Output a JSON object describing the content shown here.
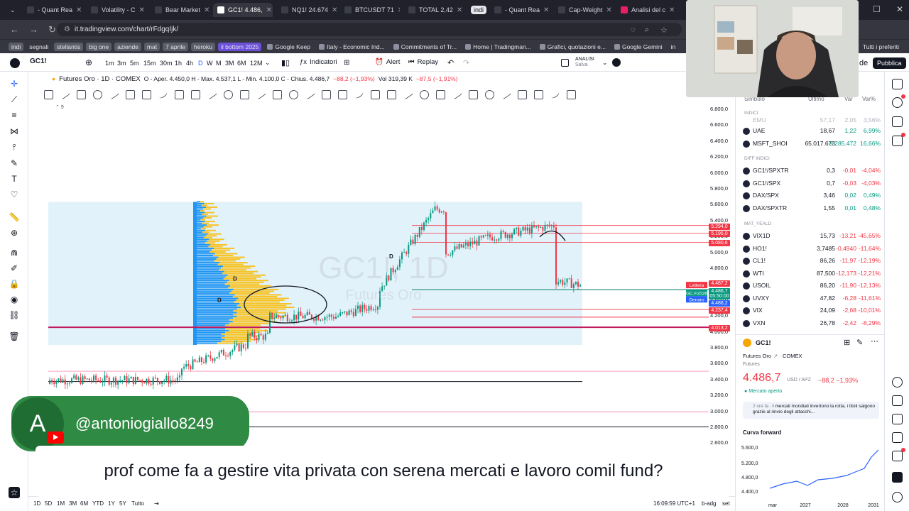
{
  "browser": {
    "tabs": [
      {
        "label": "- Quant Rea"
      },
      {
        "label": "Volatility - C"
      },
      {
        "label": "Bear Market"
      },
      {
        "label": "GC1! 4.486,"
      },
      {
        "label": "NQ1! 24.674"
      },
      {
        "label": "BTCUSDT 71"
      },
      {
        "label": "TOTAL 2,42"
      },
      {
        "label": "indi"
      },
      {
        "label": "- Quant Rea"
      },
      {
        "label": "Cap-Weight"
      },
      {
        "label": "Analisi del c"
      }
    ],
    "url": "it.tradingview.com/chart/rFdgqIjk/",
    "bookmarks": [
      "indi",
      "segnali",
      "stellantis",
      "big one",
      "aziende",
      "mat",
      "7 aprile",
      "heroku",
      "il bottom 2025",
      "Google Keep",
      "Italy - Economic Ind...",
      "Commitments of Tr...",
      "Home | Tradingman...",
      "Grafici, quotazioni e...",
      "Google Gemini",
      "in"
    ],
    "bookmarks_right": "Tutti i preferiti"
  },
  "toolbar": {
    "symbol": "GC1!",
    "timeframes": [
      "1m",
      "3m",
      "5m",
      "15m",
      "30m",
      "1h",
      "4h",
      "D",
      "W",
      "M",
      "3M",
      "6M",
      "12M"
    ],
    "selected_tf": "D",
    "indicators": "Indicatori",
    "alert": "Alert",
    "replay": "Replay",
    "analysis_top": "ANALISI",
    "analysis_bottom": "Salva",
    "publish": "Pubblica",
    "save_tail": "de"
  },
  "legend": {
    "name": "Futures Oro · 1D · COMEX",
    "ohlc": "O - Aper. 4.450,0  H - Max. 4.537,1  L - Min. 4.100,0  C - Chius. 4.486,7",
    "change": "−88,2 (−1,93%)",
    "vol": "Vol 319,39 K",
    "vol_change": "−87,5 (−1,91%)",
    "collapse": "9"
  },
  "watermark": {
    "symbol": "GC1!, 1D",
    "sub": "Futures Oro"
  },
  "price_axis": [
    "6.800,0",
    "6.600,0",
    "6.400,0",
    "6.200,0",
    "6.000,0",
    "5.800,0",
    "5.600,0",
    "5.400,0",
    "5.200,0",
    "5.000,0",
    "4.800,0",
    "4.600,0",
    "4.400,0",
    "4.200,0",
    "4.000,0",
    "3.800,0",
    "3.600,0",
    "3.400,0",
    "3.200,0",
    "3.000,0",
    "2.800,0",
    "2.600,0"
  ],
  "price_labels": [
    {
      "text": "5.294,0",
      "color": "#f23645"
    },
    {
      "text": "5.195,0",
      "color": "#f23645"
    },
    {
      "text": "5.080,6",
      "color": "#f23645"
    },
    {
      "text": "4.487,2",
      "color": "#f23645"
    },
    {
      "text": "4.486,7",
      "color": "#089981"
    },
    {
      "text": "05:50:00",
      "color": "#089981"
    },
    {
      "text": "4.486,2",
      "color": "#2962ff"
    },
    {
      "text": "4.237,4",
      "color": "#f23645"
    },
    {
      "text": "4.013,2",
      "color": "#f23645"
    }
  ],
  "side_tags": {
    "ask": "Lettera",
    "last": "GC.F2026",
    "bid": "Denaro"
  },
  "chart_marks": [
    "D",
    "D",
    "D"
  ],
  "bottombar": {
    "ranges": [
      "1D",
      "5D",
      "1M",
      "3M",
      "6M",
      "YTD",
      "1Y",
      "5Y",
      "Tutto"
    ],
    "clock": "16:09:59 UTC+1",
    "badj": "b-adg",
    "set": "set",
    "zoom": "2"
  },
  "watchlist": {
    "headers": {
      "symbol": "Simbolo",
      "last": "Ultimo",
      "chg": "Var",
      "pct": "Var%"
    },
    "sections": [
      "INDICI",
      "DIFF INDICI",
      "MAT_YEALD"
    ],
    "top_partial": {
      "name": "EMU",
      "last": "57,17",
      "chg": "2,05",
      "pct": "3,56%"
    },
    "rows_a": [
      {
        "name": "UAE",
        "last": "18,67",
        "chg": "1,22",
        "pct": "6,99%",
        "dir": "up"
      },
      {
        "name": "MSFT_SHOI",
        "last": "65.017.673",
        "chg": "9.285.472",
        "pct": "16,66%",
        "dir": "up"
      }
    ],
    "rows_b": [
      {
        "name": "GC1!/SPXTR",
        "last": "0,3",
        "chg": "-0,01",
        "pct": "-4,04%",
        "dir": "dn"
      },
      {
        "name": "GC1!/SPX",
        "last": "0,7",
        "chg": "-0,03",
        "pct": "-4,03%",
        "dir": "dn"
      },
      {
        "name": "DAX/SPX",
        "last": "3,46",
        "chg": "0,02",
        "pct": "0,49%",
        "dir": "up"
      },
      {
        "name": "DAX/SPXTR",
        "last": "1,55",
        "chg": "0,01",
        "pct": "0,48%",
        "dir": "up"
      }
    ],
    "rows_c": [
      {
        "name": "VIX1D",
        "last": "15,73",
        "chg": "-13,21",
        "pct": "-45,65%",
        "dir": "dn"
      },
      {
        "name": "HO1!",
        "last": "3,7485",
        "chg": "-0,4940",
        "pct": "-11,64%",
        "dir": "dn"
      },
      {
        "name": "CL1!",
        "last": "86,26",
        "chg": "-11,97",
        "pct": "-12,19%",
        "dir": "dn"
      },
      {
        "name": "WTI",
        "last": "87,500",
        "chg": "-12,173",
        "pct": "-12,21%",
        "dir": "dn"
      },
      {
        "name": "USOIL",
        "last": "86,20",
        "chg": "-11,90",
        "pct": "-12,13%",
        "dir": "dn"
      },
      {
        "name": "UVXY",
        "last": "47,82",
        "chg": "-6,28",
        "pct": "-11,61%",
        "dir": "dn"
      },
      {
        "name": "VIX",
        "last": "24,09",
        "chg": "-2,68",
        "pct": "-10,01%",
        "dir": "dn"
      },
      {
        "name": "VXN",
        "last": "26,78",
        "chg": "-2,42",
        "pct": "-8,29%",
        "dir": "dn"
      }
    ]
  },
  "detail": {
    "symbol": "GC1!",
    "desc": "Futures Oro",
    "exchange": "COMEX",
    "type": "Futures",
    "price": "4.486,7",
    "currency": "USD / APZ",
    "change": "−88,2  −1,93%",
    "status": "Mercato aperto",
    "news_time": "2 ore fa",
    "news": "I mercati mondiali invertono la rotta, i titoli salgono grazie al rinvio degli attacchi...",
    "curve_title": "Curva forward",
    "curve_y": [
      "5.600,0",
      "5.200,0",
      "4.800,0",
      "4.400,0"
    ],
    "curve_x": [
      "mar",
      "2027",
      "2028",
      "2031"
    ]
  },
  "overlay": {
    "avatar_letter": "A",
    "handle": "@antoniogiallo8249",
    "comment": "prof come fa a gestire vita privata con serena mercati e lavoro comil fund?"
  },
  "colors": {
    "accent": "#2962ff",
    "up": "#089981",
    "down": "#f23645",
    "profile_blue": "#2196f3",
    "profile_yellow": "#f7c325",
    "overlay_green": "#2f8a43"
  }
}
